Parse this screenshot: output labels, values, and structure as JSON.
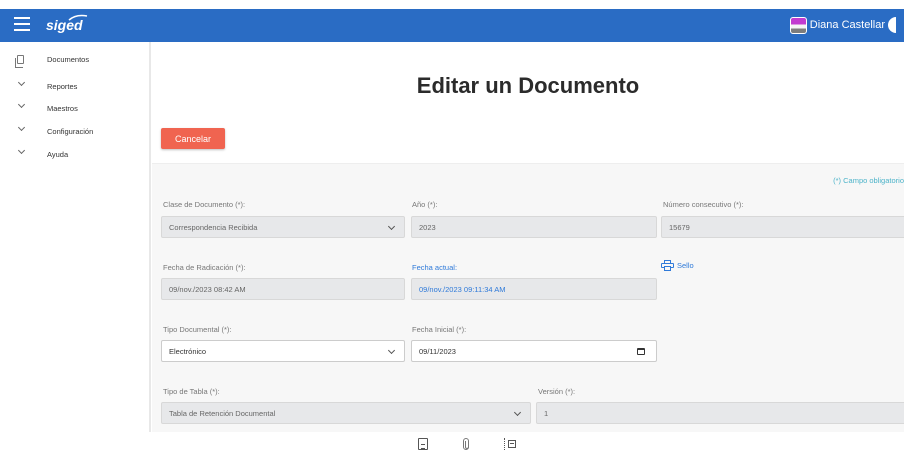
{
  "app": {
    "logo": "siged",
    "user_name": "Diana Castellar"
  },
  "sidebar": {
    "items": [
      {
        "label": "Documentos",
        "icon": "copy-icon"
      },
      {
        "label": "Reportes",
        "icon": "chevron-down-icon"
      },
      {
        "label": "Maestros",
        "icon": "chevron-down-icon"
      },
      {
        "label": "Configuración",
        "icon": "chevron-down-icon"
      },
      {
        "label": "Ayuda",
        "icon": "chevron-down-icon"
      }
    ]
  },
  "main": {
    "title": "Editar un Documento",
    "cancel_label": "Cancelar",
    "required_note": "(*) Campo obligatorio",
    "fields": {
      "clase": {
        "label": "Clase de Documento (*):",
        "value": "Correspondencia Recibida"
      },
      "anio": {
        "label": "Año (*):",
        "value": "2023"
      },
      "consecutivo": {
        "label": "Número consecutivo (*):",
        "value": "15679"
      },
      "radicacion": {
        "label": "Fecha de Radicación (*):",
        "value": "09/nov./2023 08:42 AM"
      },
      "actual": {
        "label": "Fecha actual:",
        "value": "09/nov./2023 09:11:34 AM"
      },
      "sello": {
        "label": "Sello"
      },
      "tipo_doc": {
        "label": "Tipo Documental (*):",
        "value": "Electrónico"
      },
      "fecha_inicial": {
        "label": "Fecha Inicial (*):",
        "value": "09/11/2023"
      },
      "tipo_tabla": {
        "label": "Tipo de Tabla (*):",
        "value": "Tabla de Retención Documental"
      },
      "version": {
        "label": "Versión (*):",
        "value": "1"
      }
    }
  },
  "colors": {
    "topbar": "#2a6cc4",
    "cancel": "#f06450",
    "link": "#2f7ad9",
    "note": "#4cb3c9"
  }
}
